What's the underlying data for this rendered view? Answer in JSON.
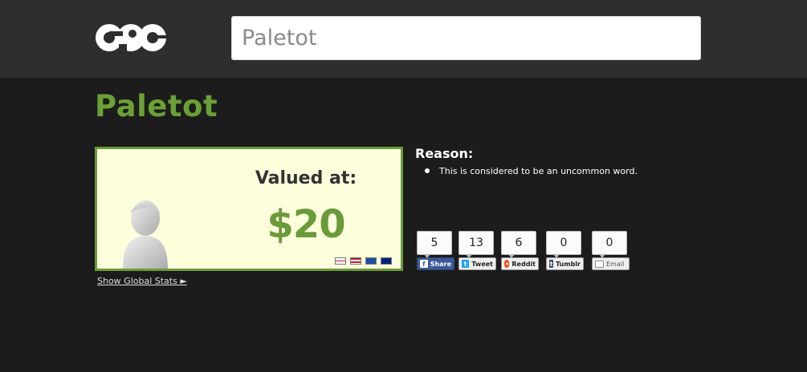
{
  "header": {
    "logo_text": "GPO",
    "search": {
      "value": "Paletot"
    }
  },
  "page": {
    "title": "Paletot"
  },
  "value_card": {
    "valued_label": "Valued at:",
    "price": "$20",
    "flags": [
      "uk-flag-icon",
      "us-flag-icon",
      "eu-flag-icon",
      "au-flag-icon"
    ]
  },
  "global_stats_link": "Show Global Stats ►",
  "reason": {
    "title": "Reason:",
    "items": [
      "This is considered to be an uncommon word."
    ]
  },
  "share": {
    "facebook": {
      "count": "5",
      "label": "Share",
      "icon": "facebook-icon"
    },
    "twitter": {
      "count": "13",
      "label": "Tweet",
      "icon": "twitter-icon"
    },
    "reddit": {
      "count": "6",
      "label": "Reddit",
      "icon": "reddit-icon"
    },
    "tumblr": {
      "count": "0",
      "label": "Tumblr",
      "icon": "tumblr-icon"
    },
    "email": {
      "count": "0",
      "label": "Email",
      "icon": "email-icon"
    }
  },
  "colors": {
    "accent_green": "#6aa036",
    "header_bg": "#2e2e2e",
    "page_bg": "#1c1c1c",
    "card_bg": "#fdfedb"
  }
}
